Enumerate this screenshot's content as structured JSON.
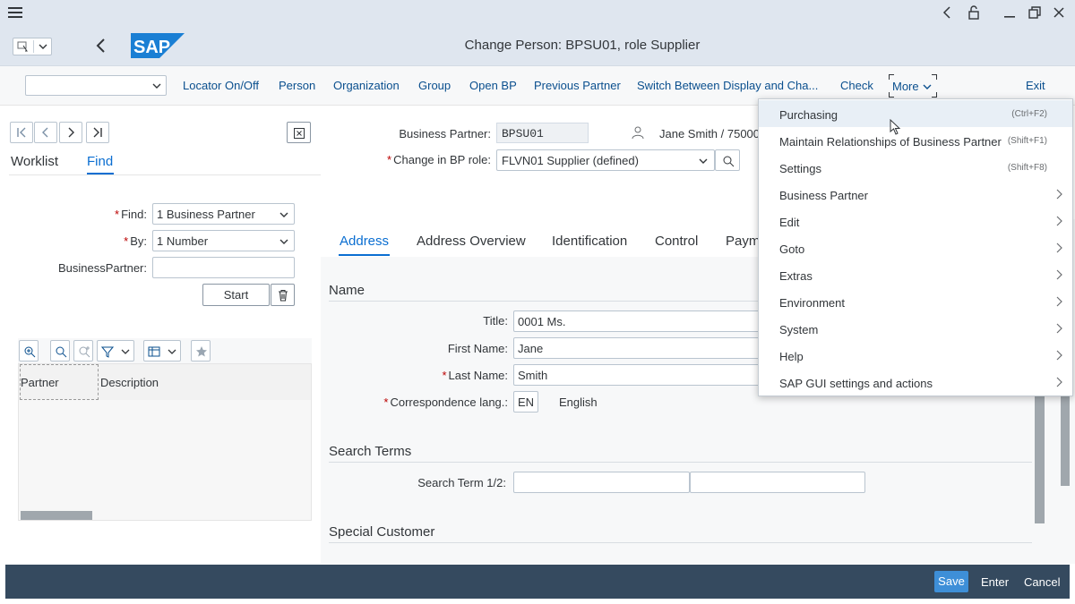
{
  "window": {
    "title": "Change Person: BPSU01, role Supplier"
  },
  "toolbar": {
    "items": [
      "Locator On/Off",
      "Person",
      "Organization",
      "Group",
      "Open BP",
      "Previous Partner",
      "Switch Between Display and Cha...",
      "Check"
    ],
    "more_label": "More",
    "exit_label": "Exit"
  },
  "left_panel": {
    "tabs": [
      "Worklist",
      "Find"
    ],
    "find_label": "Find:",
    "find_value": "1 Business Partner",
    "by_label": "By:",
    "by_value": "1 Number",
    "bp_label": "BusinessPartner:",
    "bp_value": "",
    "start_label": "Start",
    "grid_columns": [
      "Partner",
      "Description"
    ]
  },
  "header": {
    "bp_label": "Business Partner:",
    "bp_value": "BPSU01",
    "person_name": "Jane Smith / 75000",
    "role_label": "Change in BP role:",
    "role_value": "FLVN01 Supplier (defined)"
  },
  "tabs": [
    "Address",
    "Address Overview",
    "Identification",
    "Control",
    "Paym"
  ],
  "name_section": {
    "title": "Name",
    "title_label": "Title:",
    "title_value": "0001 Ms.",
    "first_label": "First Name:",
    "first_value": "Jane",
    "last_label": "Last Name:",
    "last_value": "Smith",
    "lang_label": "Correspondence lang.:",
    "lang_code": "EN",
    "lang_name": "English"
  },
  "search_section": {
    "title": "Search Terms",
    "label": "Search Term 1/2:",
    "term1": "",
    "term2": ""
  },
  "special_section": {
    "title": "Special Customer"
  },
  "more_menu": [
    {
      "label": "Purchasing",
      "shortcut": "(Ctrl+F2)",
      "submenu": false
    },
    {
      "label": "Maintain Relationships of Business Partner",
      "shortcut": "(Shift+F1)",
      "submenu": false
    },
    {
      "label": "Settings",
      "shortcut": "(Shift+F8)",
      "submenu": false
    },
    {
      "label": "Business Partner",
      "shortcut": "",
      "submenu": true
    },
    {
      "label": "Edit",
      "shortcut": "",
      "submenu": true
    },
    {
      "label": "Goto",
      "shortcut": "",
      "submenu": true
    },
    {
      "label": "Extras",
      "shortcut": "",
      "submenu": true
    },
    {
      "label": "Environment",
      "shortcut": "",
      "submenu": true
    },
    {
      "label": "System",
      "shortcut": "",
      "submenu": true
    },
    {
      "label": "Help",
      "shortcut": "",
      "submenu": true
    },
    {
      "label": "SAP GUI settings and actions",
      "shortcut": "",
      "submenu": true
    }
  ],
  "footer": {
    "save_label": "Save",
    "enter_label": "Enter",
    "cancel_label": "Cancel"
  },
  "colors": {
    "shell_bg": "#dfe6ef",
    "accent": "#0a6ed1",
    "footer_bg": "#354a5f",
    "save_btn": "#3e8fd8",
    "required": "#bb0000"
  },
  "icons": [
    "hamburger-icon",
    "back-icon",
    "unlock-icon",
    "minimize-icon",
    "restore-icon",
    "close-icon",
    "sap-logo",
    "person-icon",
    "value-help-icon",
    "delete-icon",
    "chevron-right-icon"
  ]
}
